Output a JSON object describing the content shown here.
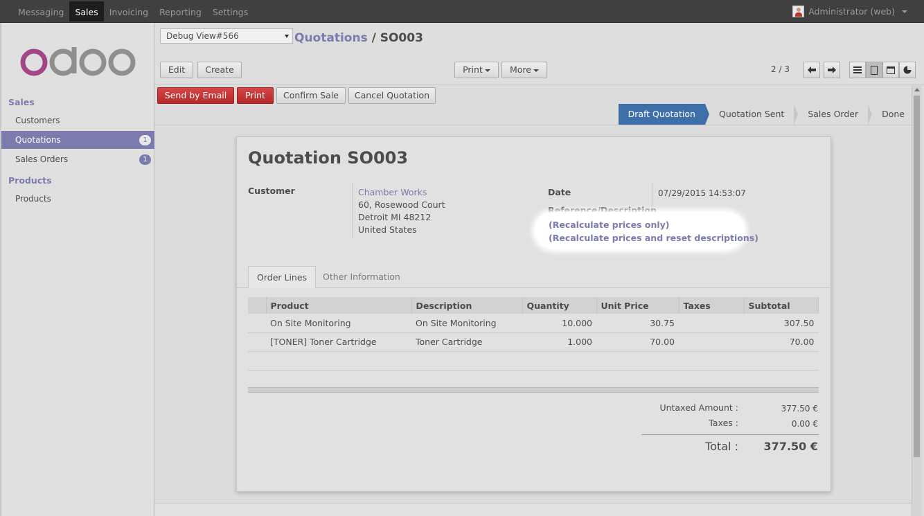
{
  "topbar": {
    "menu": [
      "Messaging",
      "Sales",
      "Invoicing",
      "Reporting",
      "Settings"
    ],
    "active_menu": "Sales",
    "user": "Administrator (web)"
  },
  "sidebar": {
    "logo_text": "odoo",
    "sections": [
      {
        "title": "Sales",
        "items": [
          {
            "label": "Customers",
            "badge": ""
          },
          {
            "label": "Quotations",
            "badge": "1",
            "active": true
          },
          {
            "label": "Sales Orders",
            "badge": "1"
          }
        ]
      },
      {
        "title": "Products",
        "items": [
          {
            "label": "Products",
            "badge": ""
          }
        ]
      }
    ]
  },
  "header": {
    "debug_select": "Debug View#566",
    "breadcrumb_parent": "Quotations",
    "breadcrumb_sep": " / ",
    "breadcrumb_current": "SO003",
    "edit_label": "Edit",
    "create_label": "Create",
    "print_label": "Print",
    "more_label": "More",
    "pager": "2 / 3"
  },
  "actions": {
    "send_email": "Send by Email",
    "print": "Print",
    "confirm": "Confirm Sale",
    "cancel": "Cancel Quotation"
  },
  "stages": [
    "Draft Quotation",
    "Quotation Sent",
    "Sales Order",
    "Done"
  ],
  "active_stage": "Draft Quotation",
  "form": {
    "title_prefix": "Quotation",
    "title_number": "SO003",
    "customer_label": "Customer",
    "customer_name": "Chamber Works",
    "address": [
      "60, Rosewood Court",
      "Detroit MI 48212",
      "United States"
    ],
    "date_label": "Date",
    "date_value": "07/29/2015 14:53:07",
    "reference_label": "Reference/Description",
    "recalc_prices": "(Recalculate prices only)",
    "recalc_reset": "(Recalculate prices and reset descriptions)"
  },
  "tabs": [
    "Order Lines",
    "Other Information"
  ],
  "order_lines": {
    "columns": [
      "Product",
      "Description",
      "Quantity",
      "Unit Price",
      "Taxes",
      "Subtotal"
    ],
    "rows": [
      {
        "product": "On Site Monitoring",
        "description": "On Site Monitoring",
        "quantity": "10.000",
        "unit_price": "30.75",
        "taxes": "",
        "subtotal": "307.50"
      },
      {
        "product": "[TONER] Toner Cartridge",
        "description": "Toner Cartridge",
        "quantity": "1.000",
        "unit_price": "70.00",
        "taxes": "",
        "subtotal": "70.00"
      }
    ]
  },
  "totals": {
    "untaxed_label": "Untaxed Amount :",
    "untaxed_value": "377.50 €",
    "taxes_label": "Taxes :",
    "taxes_value": "0.00 €",
    "total_label": "Total :",
    "total_value": "377.50 €"
  },
  "colors": {
    "brand": "#7c7bad",
    "topbar": "#404040",
    "active_stage": "#3f6fa8",
    "primary_button": "#c53030"
  }
}
